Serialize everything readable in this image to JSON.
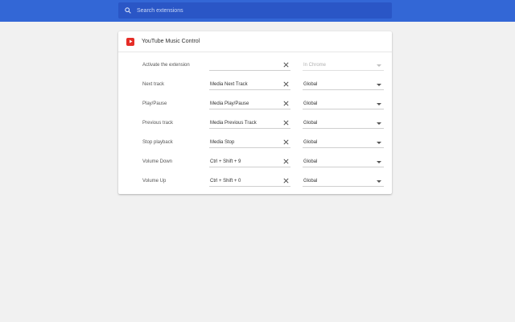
{
  "search": {
    "placeholder": "Search extensions"
  },
  "extension": {
    "name": "YouTube Music Control",
    "icon": "youtube-play-icon",
    "icon_color": "#e52d27"
  },
  "colors": {
    "topbar": "#3367d6",
    "search_bg": "#2a56c6"
  },
  "shortcuts": [
    {
      "label": "Activate the extension",
      "shortcut": "",
      "scope": "In Chrome",
      "scope_disabled": true
    },
    {
      "label": "Next track",
      "shortcut": "Media Next Track",
      "scope": "Global"
    },
    {
      "label": "Play/Pause",
      "shortcut": "Media Play/Pause",
      "scope": "Global"
    },
    {
      "label": "Previous track",
      "shortcut": "Media Previous Track",
      "scope": "Global"
    },
    {
      "label": "Stop playback",
      "shortcut": "Media Stop",
      "scope": "Global"
    },
    {
      "label": "Volume Down",
      "shortcut": "Ctrl + Shift + 9",
      "scope": "Global"
    },
    {
      "label": "Volume Up",
      "shortcut": "Ctrl + Shift + 0",
      "scope": "Global"
    }
  ]
}
